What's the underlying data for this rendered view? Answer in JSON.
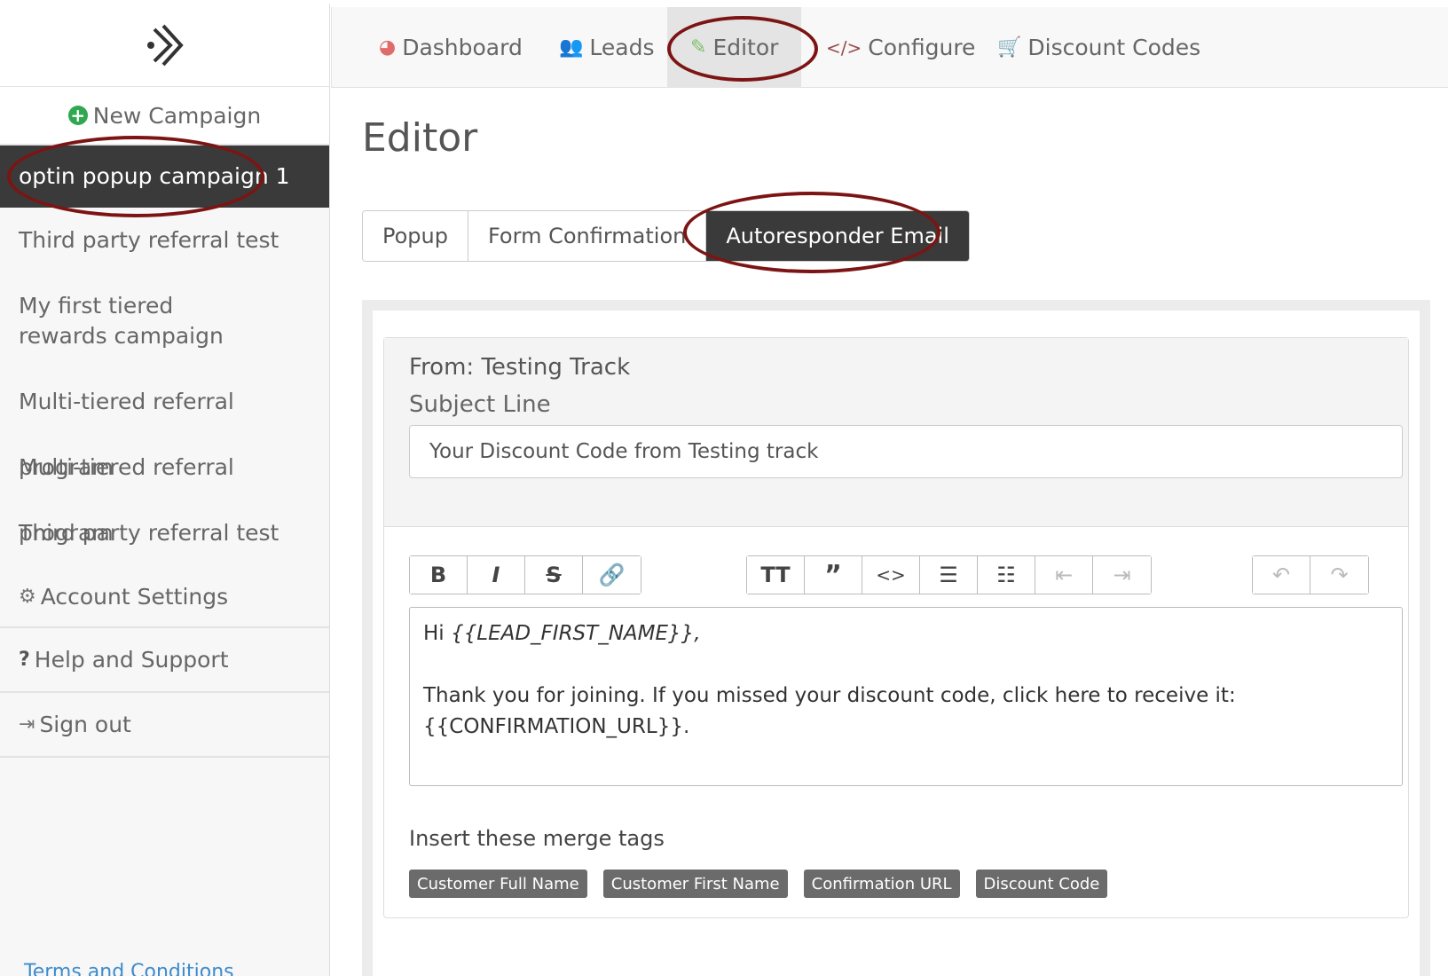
{
  "sidebar": {
    "logo_icon": "chevron-arrow-logo",
    "new_campaign": "New Campaign",
    "active_campaign": "optin popup campaign 1",
    "campaigns": [
      "Third party referral test",
      "My first tiered rewards campaign",
      "Multi-tiered referral program",
      "Multi-tiered referral program",
      "Third party referral test"
    ],
    "account_settings": "Account Settings",
    "help": "Help and Support",
    "sign_out": "Sign out",
    "terms": "Terms and Conditions"
  },
  "nav": {
    "dashboard": "Dashboard",
    "leads": "Leads",
    "editor": "Editor",
    "configure": "Configure",
    "discount_codes": "Discount Codes"
  },
  "main": {
    "title": "Editor",
    "subtabs": [
      "Popup",
      "Form Confirmation",
      "Autoresponder Email"
    ],
    "active_subtab": "Autoresponder Email"
  },
  "email": {
    "from": "From: Testing Track",
    "subject_label": "Subject Line",
    "subject_value": "Your Discount Code from Testing track",
    "body_greeting_prefix": "Hi ",
    "body_greeting_tag": "{{LEAD_FIRST_NAME}}",
    "body_greeting_suffix": ",",
    "body_line1": "Thank you for joining. If you missed your discount code, click here to receive it:",
    "body_line2": "{{CONFIRMATION_URL}}."
  },
  "merge": {
    "label": "Insert these merge tags",
    "tags": [
      "Customer Full Name",
      "Customer First Name",
      "Confirmation URL",
      "Discount Code"
    ]
  },
  "colors": {
    "highlight_ellipse": "#7d1414",
    "active_dark": "#3a3a3a",
    "link_blue": "#3d8bcd",
    "plus_green": "#2fa84f"
  }
}
